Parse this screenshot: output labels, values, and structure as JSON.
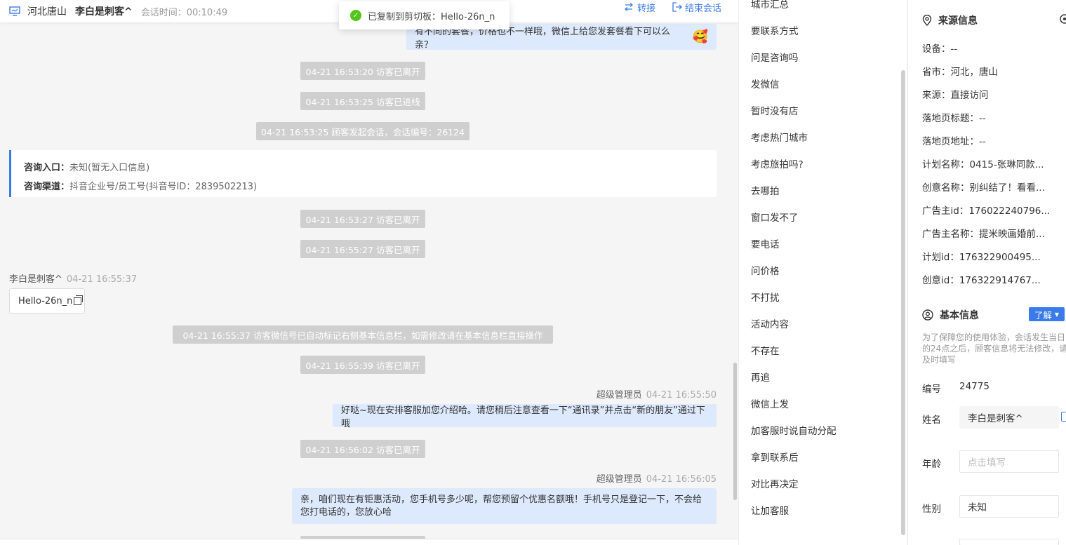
{
  "header": {
    "location": "河北唐山",
    "visitor_name": "李白是刺客^",
    "session_time": "会话时间：00:10:49",
    "transfer_label": "转接",
    "end_label": "结束会话"
  },
  "toast": {
    "text": "已复制到剪切板：Hello-26n_n"
  },
  "messages": {
    "agent_msg_1": "有不同的套餐，价格也不一样哦，微信上给您发套餐看下可以么亲？",
    "sys_1": "04-21 16:53:20 访客已离开",
    "sys_2": "04-21 16:53:25 访客已进线",
    "sys_3": "04-21 16:53:25 顾客发起会话，会话编号：26124",
    "entry_label": "咨询入口：",
    "entry_value": "未知(暂无入口信息)",
    "channel_label": "咨询渠道：",
    "channel_value": "抖音企业号/员工号(抖音号ID：2839502213)",
    "sys_4": "04-21 16:53:27 访客已离开",
    "sys_5": "04-21 16:55:27 访客已离开",
    "visitor_name": "李白是刺客^",
    "visitor_time": "04-21 16:55:37",
    "visitor_msg": "Hello-26n_n",
    "sys_6": "04-21 16:55:37 访客微信号已自动标记右侧基本信息栏，如需修改请在基本信息栏直接操作",
    "sys_7": "04-21 16:55:39 访客已离开",
    "agent_name_1": "超级管理员",
    "agent_time_1": "04-21 16:55:50",
    "agent_msg_2": "好哒~现在安排客服加您介绍哈。请您稍后注意查看一下“通讯录”并点击“新的朋友”通过下哦",
    "sys_8": "04-21 16:56:02 访客已离开",
    "agent_name_2": "超级管理员",
    "agent_time_2": "04-21 16:56:05",
    "agent_msg_3_line1": "亲，咱们现在有钜惠活动，您手机号多少呢，帮您预留个优惠名额哦！手机号只是登记一下，不会给",
    "agent_msg_3_line2": "您打电话的，您放心哈"
  },
  "quick_replies": [
    "城市汇总",
    "要联系方式",
    "问是咨询吗",
    "发微信",
    "暂时没有店",
    "考虑热门城市",
    "考虑旅拍吗?",
    "去哪拍",
    "窗口发不了",
    "要电话",
    "问价格",
    "不打扰",
    "活动内容",
    "不存在",
    "再追",
    "微信上发",
    "加客服时说自动分配",
    "拿到联系后",
    "对比再决定",
    "让加客服"
  ],
  "source_info": {
    "title": "来源信息",
    "device": "设备：--",
    "province_city": "省市：河北，唐山",
    "source": "来源：直接访问",
    "landing_title": "落地页标题：--",
    "landing_url": "落地页地址：--",
    "plan_name": "计划名称：0415-张琳同款...",
    "creative_name": "创意名称：别纠结了！看看...",
    "advertiser_id": "广告主id：176022240796...",
    "advertiser_name": "广告主名称：提米映画婚前...",
    "plan_id": "计划id：176322900495...",
    "creative_id": "创意id：176322914767..."
  },
  "basic_info": {
    "title": "基本信息",
    "learn_more": "了解",
    "note": "为了保障您的使用体验，会话发生当日的24点之后，顾客信息将无法修改，请及时填写",
    "id_label": "编号",
    "id_value": "24775",
    "name_label": "姓名",
    "name_value": "李白是刺客^",
    "age_label": "年龄",
    "age_placeholder": "点击填写",
    "gender_label": "性别",
    "gender_value": "未知"
  },
  "colors": {
    "accent": "#3b7be9",
    "agent_bubble": "#dde9fc",
    "system_msg": "#cfcfcf",
    "success": "#52c41a"
  }
}
